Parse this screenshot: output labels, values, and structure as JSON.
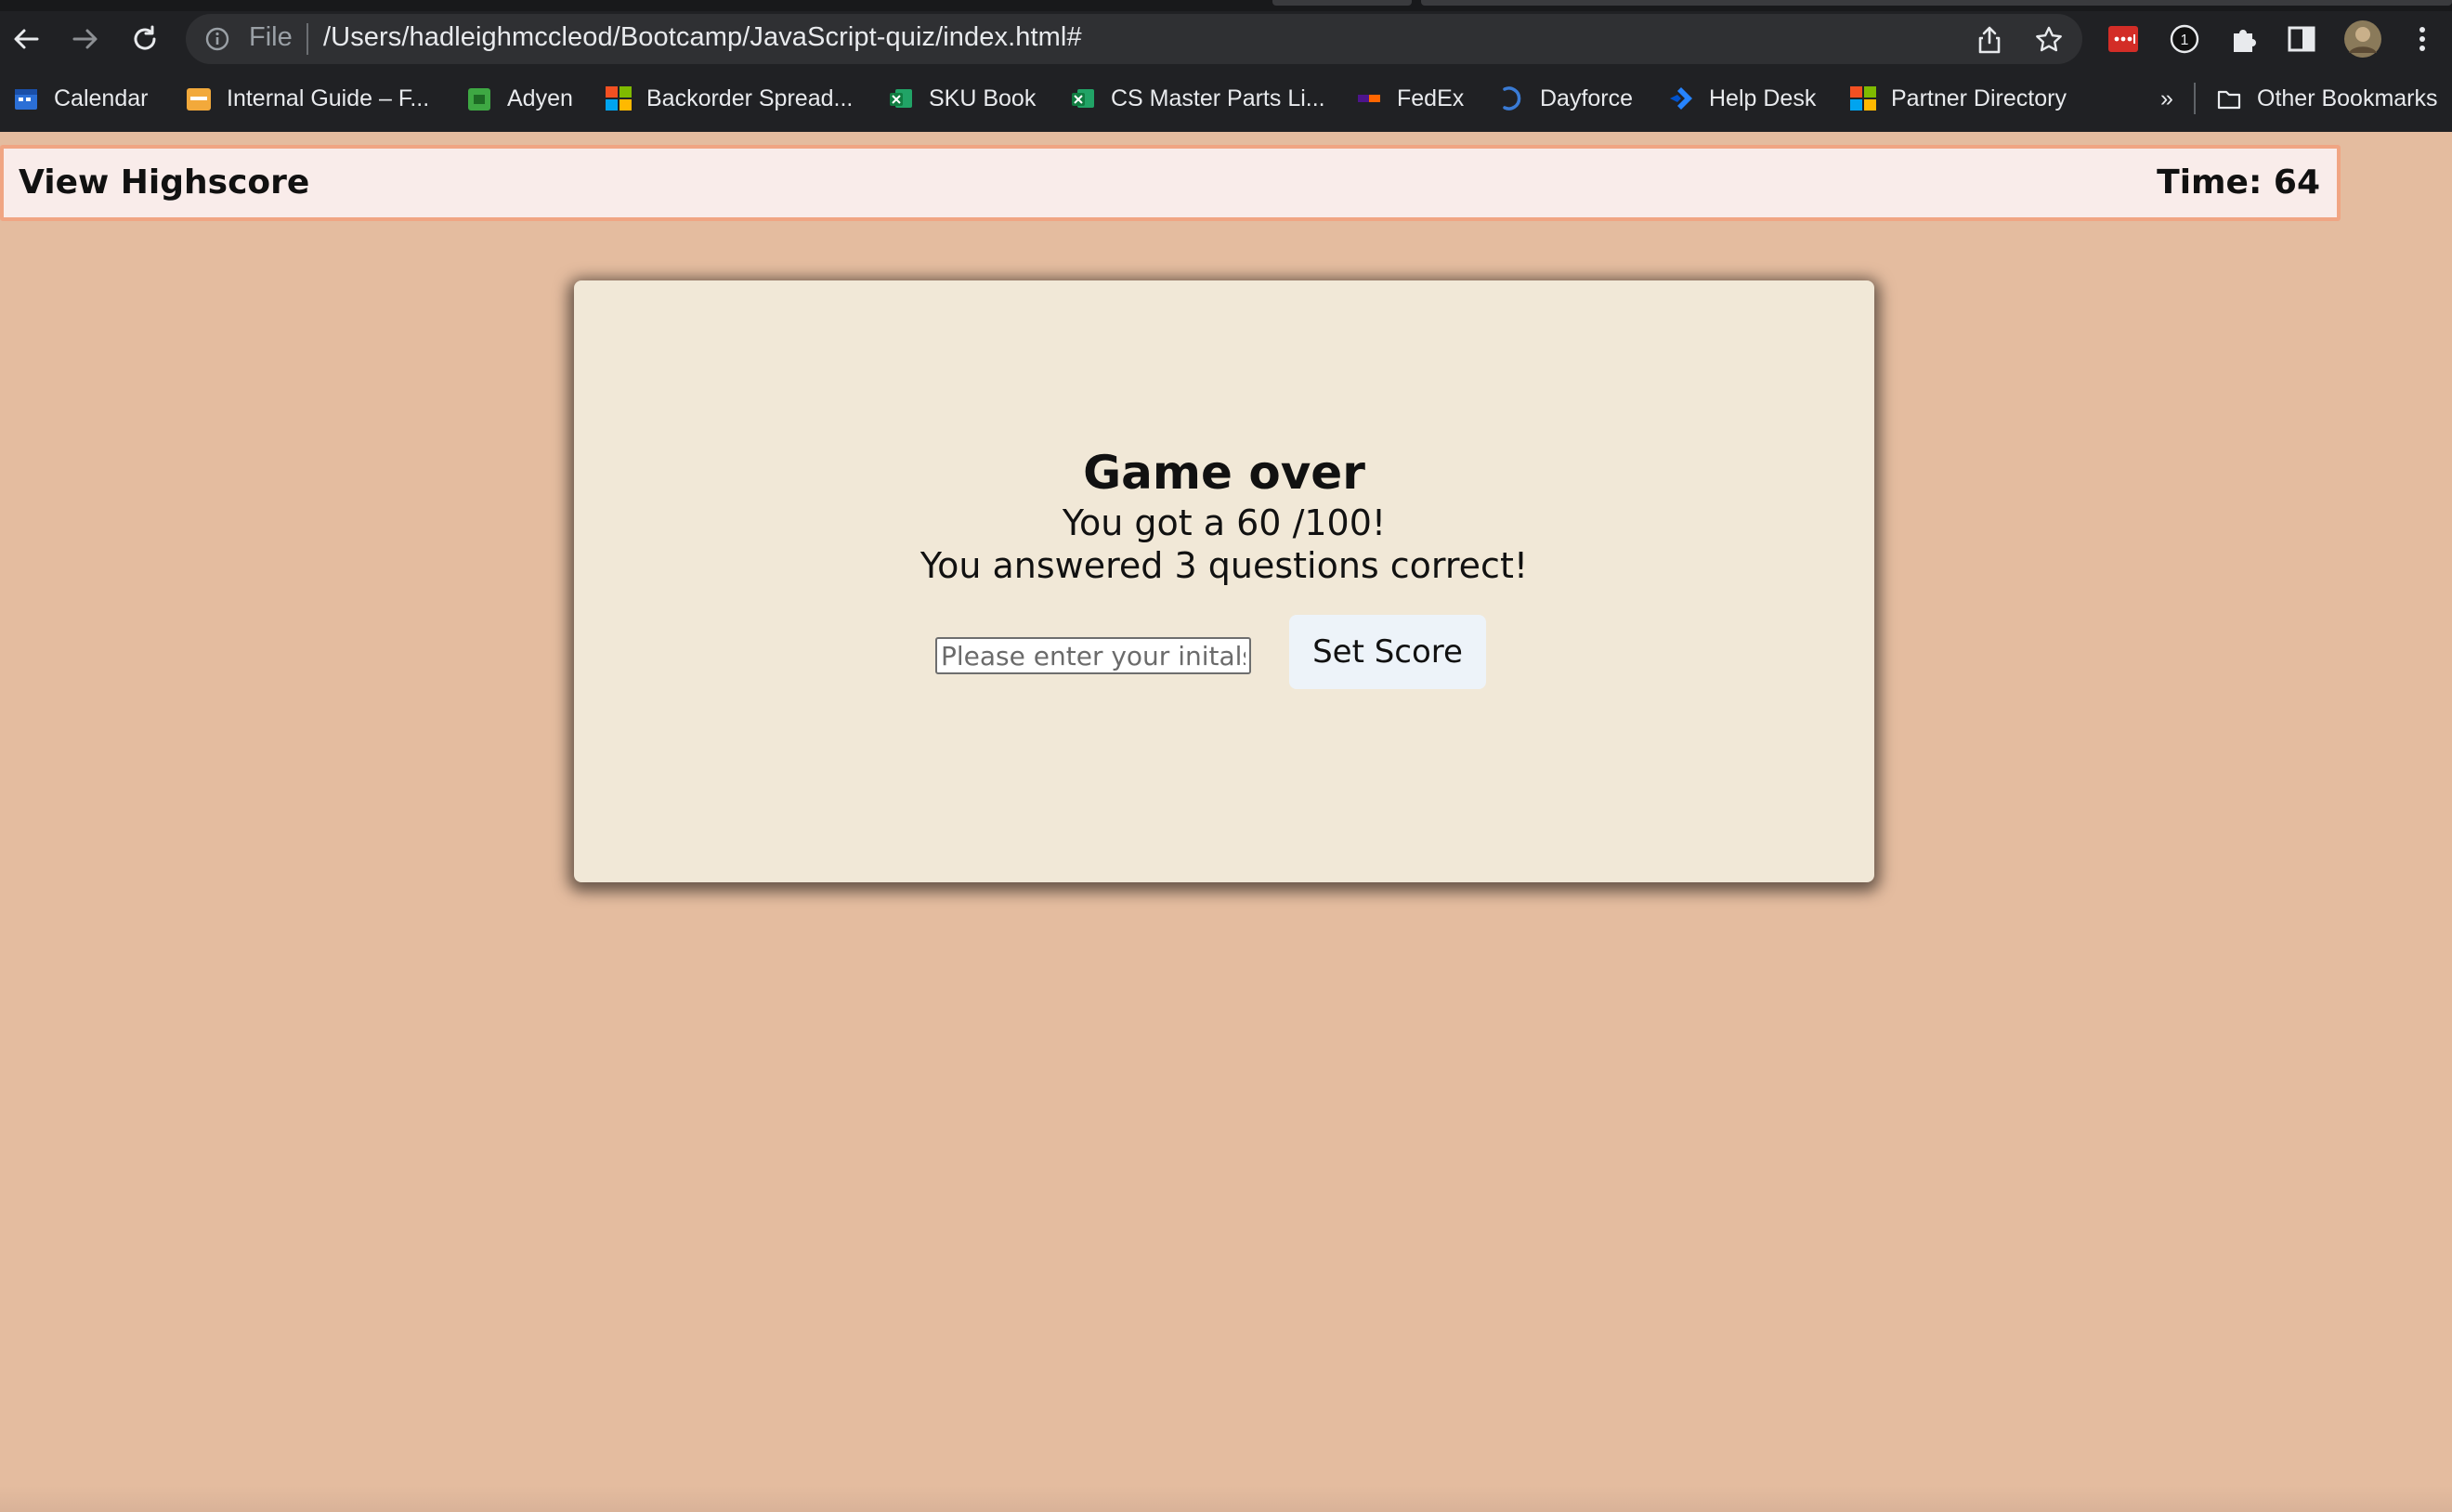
{
  "browser": {
    "address_scheme": "File",
    "address_url": "/Users/hadleighmccleod/Bootcamp/JavaScript-quiz/index.html#",
    "bookmarks": [
      {
        "label": "Calendar",
        "icon": "calendar-icon"
      },
      {
        "label": "Internal Guide – F...",
        "icon": "internal-guide-icon"
      },
      {
        "label": "Adyen",
        "icon": "adyen-icon"
      },
      {
        "label": "Backorder Spread...",
        "icon": "microsoft-icon"
      },
      {
        "label": "SKU Book",
        "icon": "excel-icon"
      },
      {
        "label": "CS Master Parts Li...",
        "icon": "excel-icon"
      },
      {
        "label": "FedEx",
        "icon": "fedex-icon"
      },
      {
        "label": "Dayforce",
        "icon": "dayforce-icon"
      },
      {
        "label": "Help Desk",
        "icon": "jira-icon"
      },
      {
        "label": "Partner Directory",
        "icon": "microsoft-icon"
      }
    ],
    "overflow_label": "»",
    "other_bookmarks": "Other Bookmarks",
    "extension_badge": "1"
  },
  "header": {
    "highscore_link": "View Highscore",
    "timer": "Time: 64"
  },
  "result": {
    "title": "Game over",
    "score_line": "You got a 60 /100!",
    "correct_line": "You answered 3 questions correct!",
    "initials_placeholder": "Please enter your initals",
    "submit_label": "Set Score"
  },
  "colors": {
    "page_background": "#e4bc9f",
    "header_background": "#f9ecea",
    "header_border": "#f0a583",
    "card_background": "#f1e8d7",
    "button_background": "#edf3f9"
  }
}
